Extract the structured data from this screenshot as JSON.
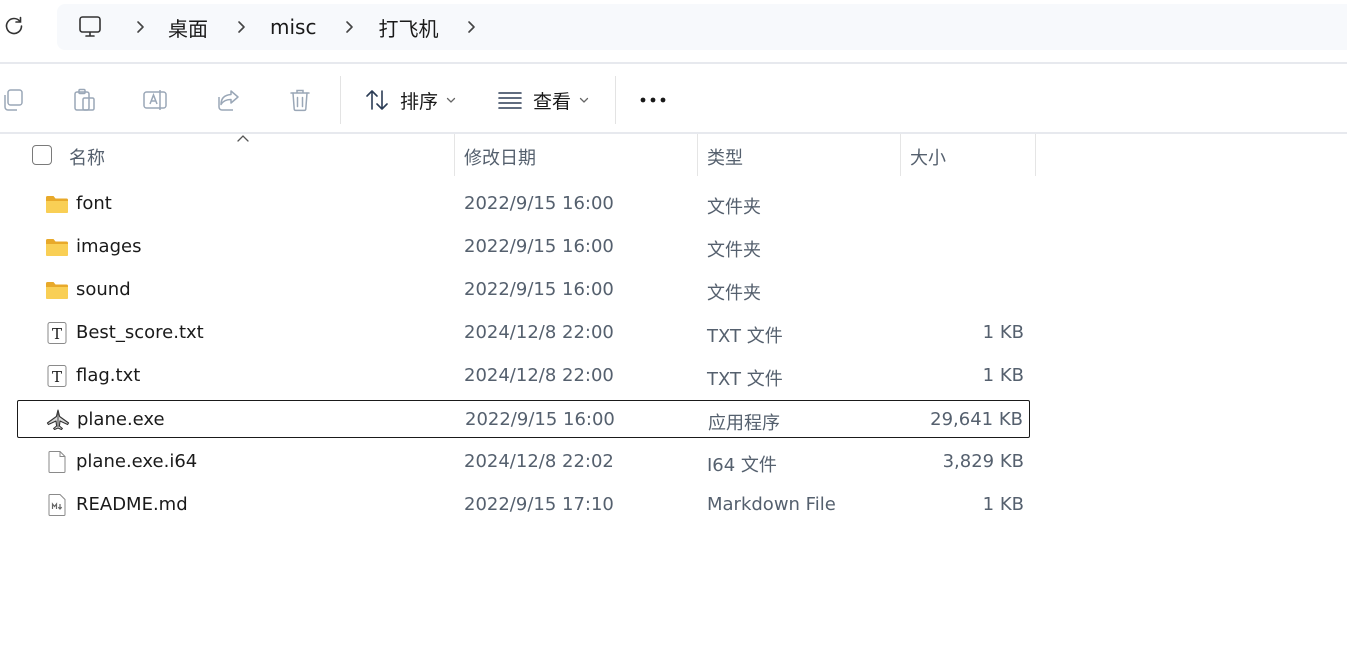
{
  "breadcrumb": {
    "items": [
      "桌面",
      "misc",
      "打飞机"
    ]
  },
  "toolbar": {
    "sort_label": "排序",
    "view_label": "查看",
    "icons": [
      "copy-icon",
      "paste-icon",
      "rename-icon",
      "share-icon",
      "delete-icon",
      "sort-icon",
      "view-icon",
      "more-icon"
    ]
  },
  "columns": {
    "name": "名称",
    "date": "修改日期",
    "type": "类型",
    "size": "大小"
  },
  "files": [
    {
      "name": "font",
      "date": "2022/9/15 16:00",
      "type": "文件夹",
      "size": "",
      "icon": "folder-icon"
    },
    {
      "name": "images",
      "date": "2022/9/15 16:00",
      "type": "文件夹",
      "size": "",
      "icon": "folder-icon"
    },
    {
      "name": "sound",
      "date": "2022/9/15 16:00",
      "type": "文件夹",
      "size": "",
      "icon": "folder-icon"
    },
    {
      "name": "Best_score.txt",
      "date": "2024/12/8 22:00",
      "type": "TXT 文件",
      "size": "1 KB",
      "icon": "text-file-icon"
    },
    {
      "name": "flag.txt",
      "date": "2024/12/8 22:00",
      "type": "TXT 文件",
      "size": "1 KB",
      "icon": "text-file-icon"
    },
    {
      "name": "plane.exe",
      "date": "2022/9/15 16:00",
      "type": "应用程序",
      "size": "29,641 KB",
      "icon": "plane-app-icon"
    },
    {
      "name": "plane.exe.i64",
      "date": "2024/12/8 22:02",
      "type": "I64 文件",
      "size": "3,829 KB",
      "icon": "blank-file-icon"
    },
    {
      "name": "README.md",
      "date": "2022/9/15 17:10",
      "type": "Markdown File",
      "size": "1 KB",
      "icon": "markdown-file-icon"
    }
  ],
  "colors": {
    "accent": "#2b3c55",
    "folder": "#f7c94b",
    "disabled_icon": "#9aa7b7"
  }
}
